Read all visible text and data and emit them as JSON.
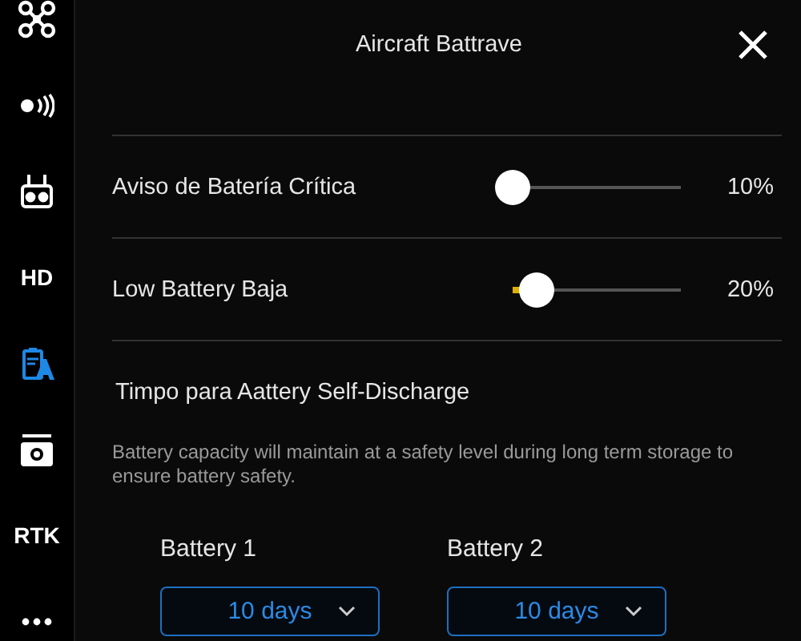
{
  "sidebar": {
    "items": [
      {
        "kind": "drone",
        "selected": false
      },
      {
        "kind": "signal",
        "selected": false
      },
      {
        "kind": "remote",
        "selected": false
      },
      {
        "kind": "text",
        "label": "HD",
        "selected": false
      },
      {
        "kind": "battery",
        "selected": true
      },
      {
        "kind": "camera",
        "selected": false
      },
      {
        "kind": "text",
        "label": "RTK",
        "selected": false
      },
      {
        "kind": "more",
        "selected": false
      }
    ]
  },
  "panel": {
    "title": "Aircraft Battrave",
    "sliders": [
      {
        "label": "Aviso de Batería Crítica",
        "level": 0.0,
        "reading": "10%"
      },
      {
        "label": "Low Battery Baja",
        "level": 0.14,
        "reading": "20%"
      }
    ],
    "section_title": "Timpo para Aattery Self-Discharge",
    "description": "Battery capacity will maintain at a safety level during long term storage to ensure battery safety.",
    "batteries": [
      {
        "label": "Battery 1",
        "value": "10 days"
      },
      {
        "label": "Battery 2",
        "value": "10 days"
      }
    ]
  }
}
